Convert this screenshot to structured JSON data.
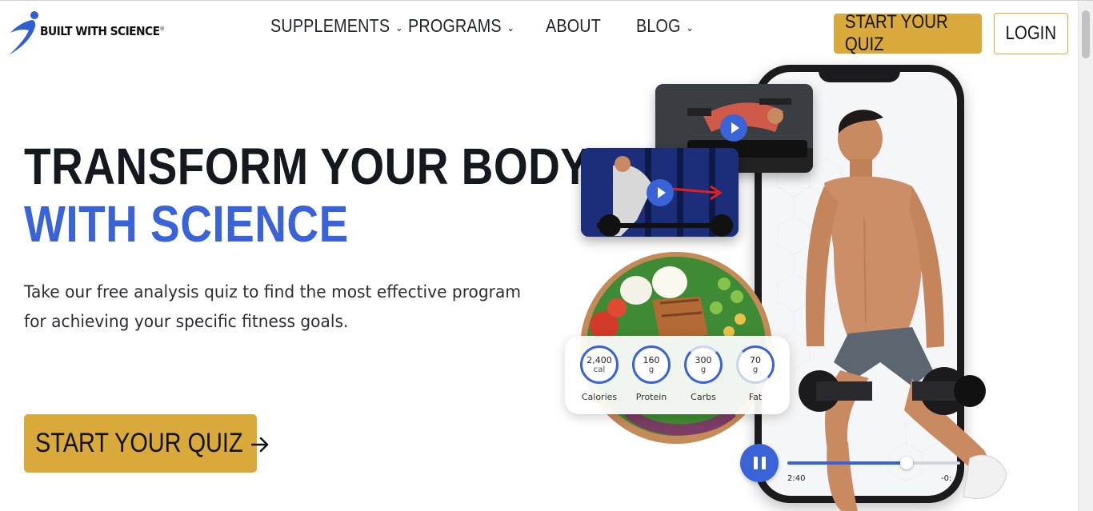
{
  "brand": {
    "name": "BUILT WITH SCIENCE",
    "mark": "®"
  },
  "nav": [
    {
      "label": "SUPPLEMENTS",
      "has_dropdown": true
    },
    {
      "label": "PROGRAMS",
      "has_dropdown": true
    },
    {
      "label": "ABOUT",
      "has_dropdown": false
    },
    {
      "label": "BLOG",
      "has_dropdown": true
    }
  ],
  "header_actions": {
    "quiz_label": "START YOUR QUIZ",
    "login_label": "LOGIN"
  },
  "hero": {
    "title_line1": "TRANSFORM YOUR BODY",
    "title_line2": "WITH SCIENCE",
    "subtitle": "Take our free analysis quiz to find the most effective program for achieving your specific fitness goals.",
    "cta_label": "START YOUR QUIZ"
  },
  "macros": [
    {
      "value": "2,400",
      "unit": "cal",
      "label": "Calories",
      "fill": 1.0
    },
    {
      "value": "160",
      "unit": "g",
      "label": "Protein",
      "fill": 1.0
    },
    {
      "value": "300",
      "unit": "g",
      "label": "Carbs",
      "fill": 0.85
    },
    {
      "value": "70",
      "unit": "g",
      "label": "Fat",
      "fill": 0.3
    }
  ],
  "player": {
    "elapsed": "2:40",
    "remaining": "-0:",
    "progress": 0.69
  },
  "colors": {
    "accent_gold": "#d9aa3b",
    "brand_blue": "#3a63d8",
    "text_dark": "#14181f"
  },
  "icons": {
    "dropdown": "chevron-down-icon",
    "cta": "arrow-right-icon",
    "video": "play-icon",
    "player": "pause-icon"
  }
}
